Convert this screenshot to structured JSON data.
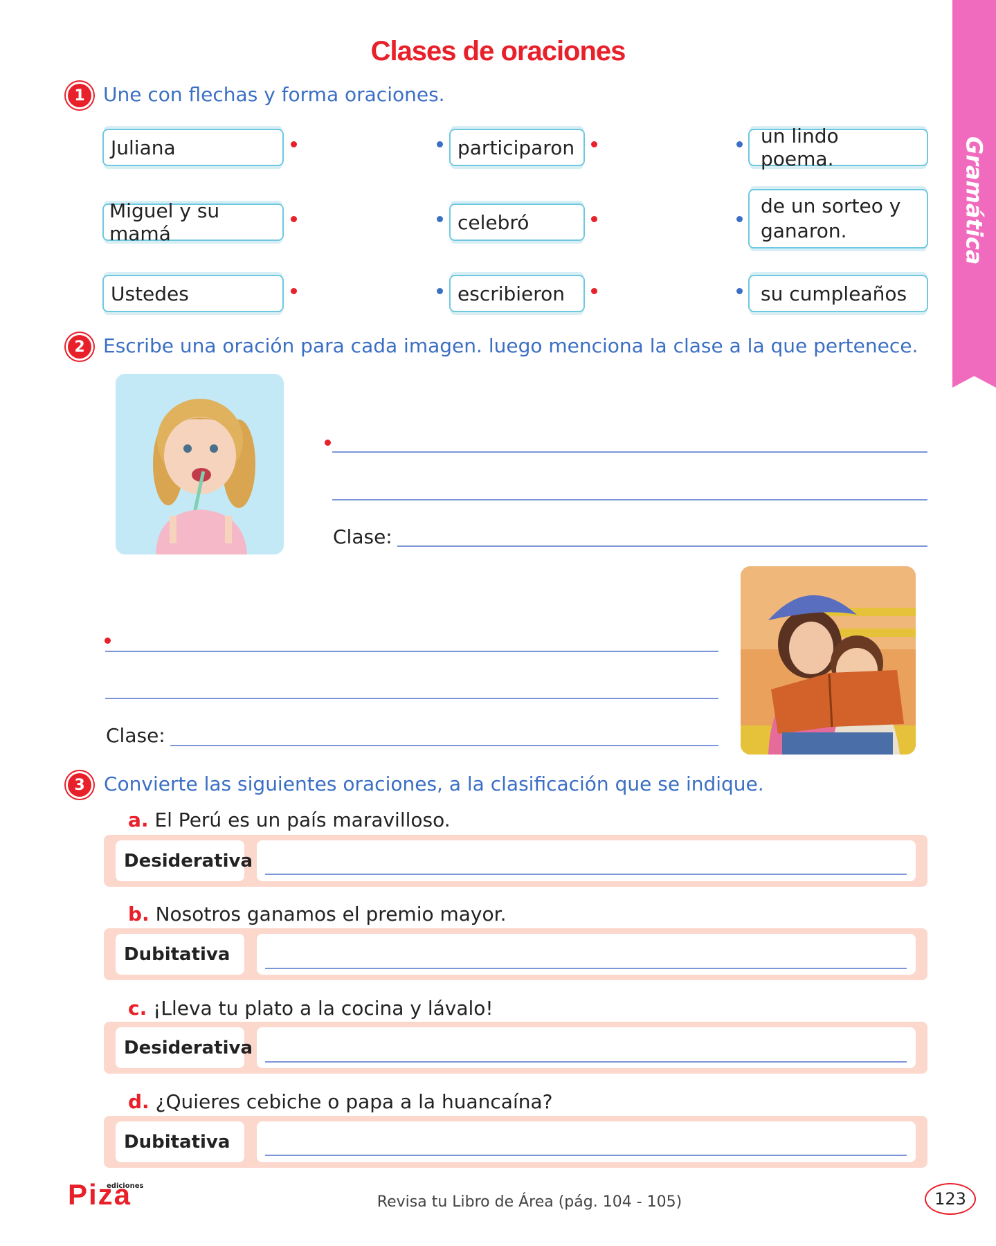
{
  "side_tab": "Gramática",
  "title": "Clases de oraciones",
  "section1": {
    "number": "1",
    "instruction": "Une con flechas y forma oraciones.",
    "col1": [
      "Juliana",
      "Miguel y su mamá",
      "Ustedes"
    ],
    "col2": [
      "participaron",
      "celebró",
      "escribieron"
    ],
    "col3": [
      "un lindo poema.",
      "de un sorteo y ganaron.",
      "su cumpleaños"
    ]
  },
  "section2": {
    "number": "2",
    "instruction": "Escribe una oración para cada imagen. luego menciona la clase a la que pertenece.",
    "clase_label": "Clase:"
  },
  "section3": {
    "number": "3",
    "instruction": "Convierte las siguientes oraciones, a la clasificación que se indique.",
    "items": [
      {
        "letter": "a.",
        "sentence": "El Perú es un país maravilloso.",
        "type": "Desiderativa"
      },
      {
        "letter": "b.",
        "sentence": "Nosotros ganamos el premio mayor.",
        "type": "Dubitativa"
      },
      {
        "letter": "c.",
        "sentence": "¡Lleva tu plato a la cocina y lávalo!",
        "type": "Desiderativa"
      },
      {
        "letter": "d.",
        "sentence": "¿Quieres cebiche o papa a la huancaína?",
        "type": "Dubitativa"
      }
    ]
  },
  "footer": {
    "logo": "Piza",
    "logo_sub": "ediciones",
    "note": "Revisa tu Libro de Área (pág. 104 - 105)",
    "page": "123"
  }
}
